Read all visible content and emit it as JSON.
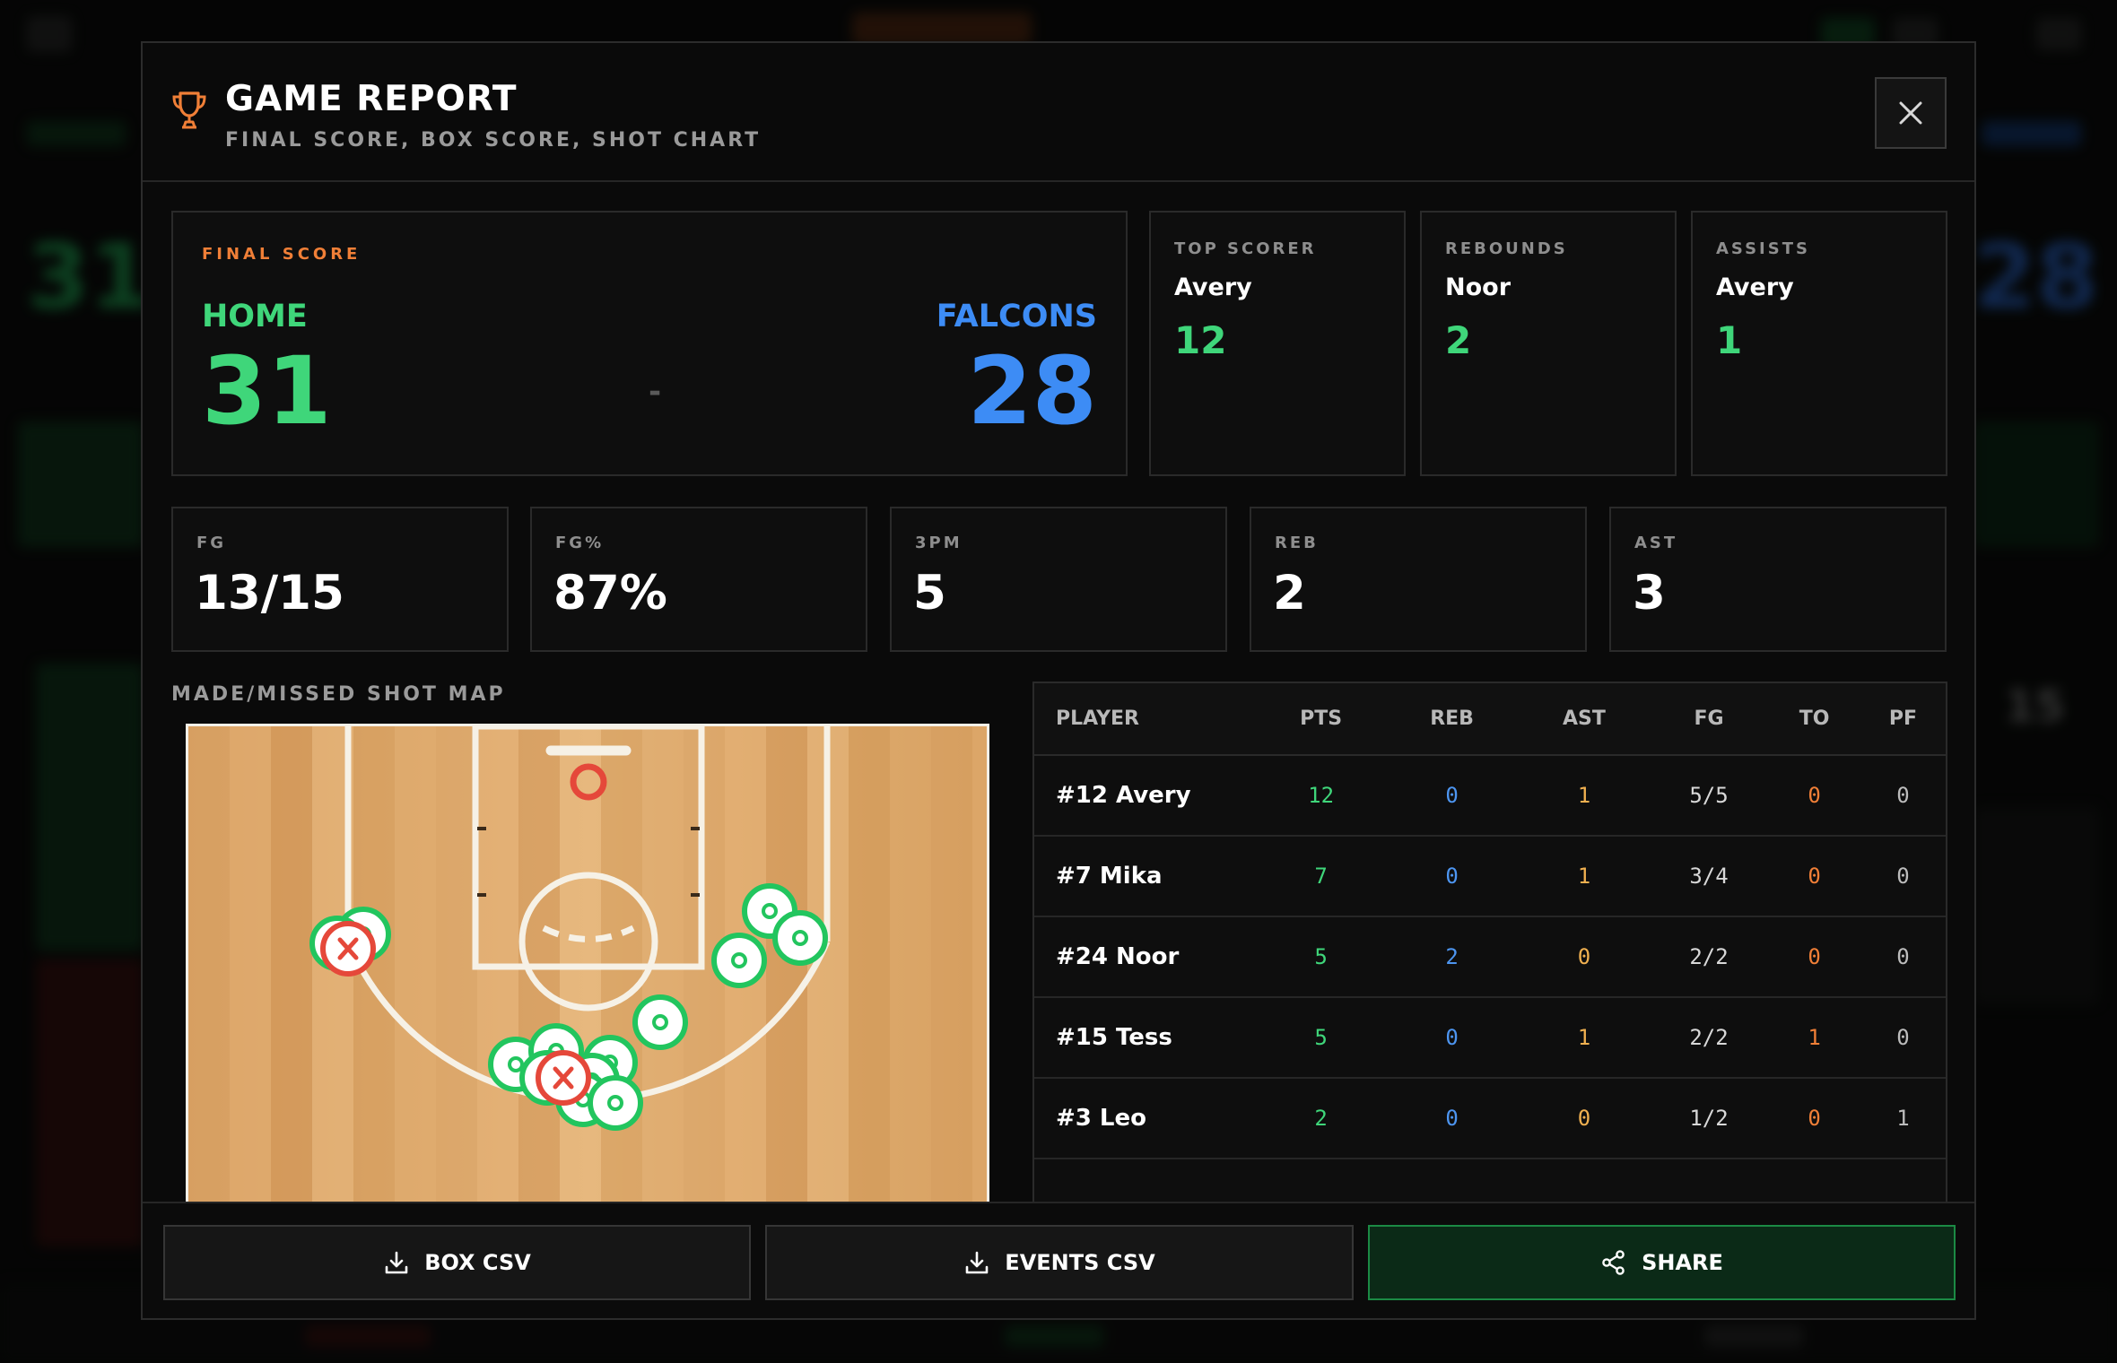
{
  "background": {
    "home_score": "31",
    "away_score": "28",
    "clock": "15"
  },
  "modal": {
    "title": "GAME REPORT",
    "subtitle": "FINAL SCORE, BOX SCORE, SHOT CHART",
    "close_icon": "close-icon",
    "trophy_icon": "trophy-icon"
  },
  "final_score": {
    "label": "FINAL SCORE",
    "home_name": "HOME",
    "home_score": "31",
    "separator": "-",
    "away_name": "FALCONS",
    "away_score": "28",
    "home_color": "#3fd67a",
    "away_color": "#3d8cf5"
  },
  "leaders": [
    {
      "label": "TOP SCORER",
      "name": "Avery",
      "value": "12"
    },
    {
      "label": "REBOUNDS",
      "name": "Noor",
      "value": "2"
    },
    {
      "label": "ASSISTS",
      "name": "Avery",
      "value": "1"
    }
  ],
  "team_stats": [
    {
      "label": "FG",
      "value": "13/15"
    },
    {
      "label": "FG%",
      "value": "87%"
    },
    {
      "label": "3PM",
      "value": "5"
    },
    {
      "label": "REB",
      "value": "2"
    },
    {
      "label": "AST",
      "value": "3"
    }
  ],
  "shot_map": {
    "title": "MADE/MISSED SHOT MAP",
    "made_color": "#22c55e",
    "missed_color": "#e5483a",
    "made_count": 13,
    "missed_count": 2
  },
  "box_score": {
    "columns": [
      "PLAYER",
      "PTS",
      "REB",
      "AST",
      "FG",
      "TO",
      "PF"
    ],
    "rows": [
      {
        "player": "#12 Avery",
        "pts": "12",
        "reb": "0",
        "ast": "1",
        "fg": "5/5",
        "to": "0",
        "pf": "0"
      },
      {
        "player": "#7 Mika",
        "pts": "7",
        "reb": "0",
        "ast": "1",
        "fg": "3/4",
        "to": "0",
        "pf": "0"
      },
      {
        "player": "#24 Noor",
        "pts": "5",
        "reb": "2",
        "ast": "0",
        "fg": "2/2",
        "to": "0",
        "pf": "0"
      },
      {
        "player": "#15 Tess",
        "pts": "5",
        "reb": "0",
        "ast": "1",
        "fg": "2/2",
        "to": "1",
        "pf": "0"
      },
      {
        "player": "#3 Leo",
        "pts": "2",
        "reb": "0",
        "ast": "0",
        "fg": "1/2",
        "to": "0",
        "pf": "1"
      }
    ]
  },
  "footer": {
    "box_csv_label": "BOX CSV",
    "events_csv_label": "EVENTS CSV",
    "share_label": "SHARE",
    "download_icon": "download-icon",
    "share_icon": "share-icon",
    "share_color": "#1b8a44"
  }
}
